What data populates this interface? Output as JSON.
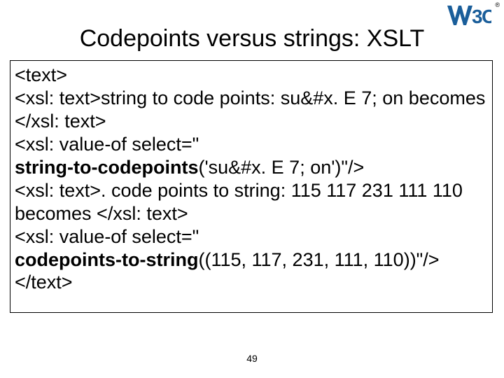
{
  "logo": {
    "letters": "W3C"
  },
  "title": "Codepoints versus strings: XSLT",
  "code": {
    "l1": "<text>",
    "l2": " <xsl: text>string to code points:  su&#x. E 7; on becomes </xsl: text>",
    "l3": "<xsl: value-of select=\"",
    "fn1": "string-to-codepoints",
    "l3b": "('su&#x. E 7; on')\"/>",
    "l4": "<xsl: text>. code points to string:  115 117  231 111 110 becomes </xsl: text>",
    "l5": "<xsl: value-of select=\"",
    "fn2": "codepoints-to-string",
    "l5b": "((115, 117, 231, 111, 110))\"/>",
    "l6": "</text>"
  },
  "page_number": "49"
}
